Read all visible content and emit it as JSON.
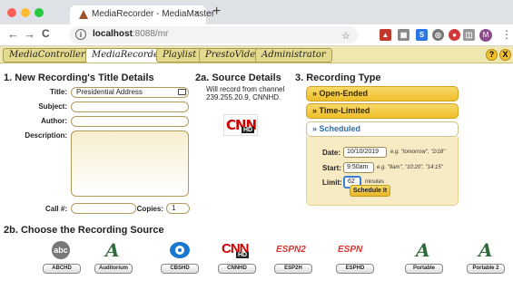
{
  "browser": {
    "tab_title": "MediaRecorder - MediaMaster",
    "tab_close": "×",
    "new_tab": "+",
    "back": "←",
    "forward": "→",
    "reload": "C",
    "url_host": "localhost",
    "url_rest": ":8088/mr",
    "star": "☆",
    "avatar": "M",
    "menu": "⋮"
  },
  "app_nav": {
    "tabs": [
      {
        "label": "MediaController"
      },
      {
        "label": "MediaRecorder"
      },
      {
        "label": "Playlist"
      },
      {
        "label": "PrestoVideo"
      },
      {
        "label": "Administrator"
      }
    ],
    "help": "?",
    "close": "X"
  },
  "section1": {
    "heading": "1. New Recording's Title Details",
    "title_label": "Title:",
    "title_value": "Presidential Address",
    "subject_label": "Subject:",
    "author_label": "Author:",
    "description_label": "Description:",
    "call_label": "Call #:",
    "copies_label": "Copies:",
    "copies_value": "1"
  },
  "section2a": {
    "heading": "2a. Source Details",
    "note": "Will record from channel 239.255.20.9, CNNHD.",
    "logo_text": "CNN",
    "logo_sub": "HD"
  },
  "section3": {
    "heading": "3. Recording Type",
    "options": [
      {
        "label": "» Open-Ended"
      },
      {
        "label": "» Time-Limited"
      },
      {
        "label": "» Scheduled"
      }
    ],
    "date_label": "Date:",
    "date_value": "10/10/2019",
    "date_hint": "e.g. \"tomorrow\", \"2/18\"",
    "start_label": "Start:",
    "start_value": "9:50am",
    "start_hint": "e.g. \"9am\", \"10:20\", \"14:15\"",
    "limit_label": "Limit:",
    "limit_value": "62",
    "limit_unit": "minutes",
    "schedule_button": "Schedule It"
  },
  "section2b": {
    "heading": "2b. Choose the Recording Source",
    "sources": [
      {
        "label": "ABCHD",
        "logo": "abc"
      },
      {
        "label": "Auditorium",
        "logo": "A"
      },
      {
        "label": "CBSHD",
        "logo": "eye"
      },
      {
        "label": "CNNHD",
        "logo": "CNN"
      },
      {
        "label": "ESP2H",
        "logo": "ESPN2"
      },
      {
        "label": "ESPHD",
        "logo": "ESPN"
      },
      {
        "label": "Portable",
        "logo": "A"
      },
      {
        "label": "Portable 2",
        "logo": "A"
      }
    ]
  },
  "colors": {
    "accent_gold": "#efbf2b",
    "nav_bg": "#efe7b0",
    "cnn_red": "#cc0000",
    "focus_blue": "#3b7dd8"
  }
}
